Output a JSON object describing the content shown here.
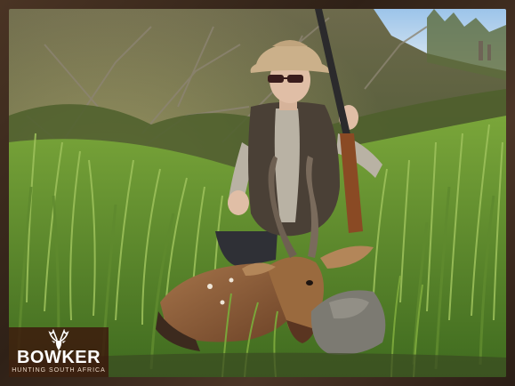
{
  "photo": {
    "subject": "hunter kneeling with bushbuck trophy in tall grass",
    "colors": {
      "frame": "#3a2a1e",
      "sky": "#bcd6ee",
      "grass": "#5f8a2e",
      "hat": "#cbb08a",
      "vest": "#4a4036",
      "shirt": "#b9b2a4",
      "animal": "#8a5a36"
    }
  },
  "logo": {
    "brand": "BOWKER",
    "tagline": "HUNTING SOUTH AFRICA",
    "icon": "kudu-head-icon",
    "background": "#3c160c"
  }
}
